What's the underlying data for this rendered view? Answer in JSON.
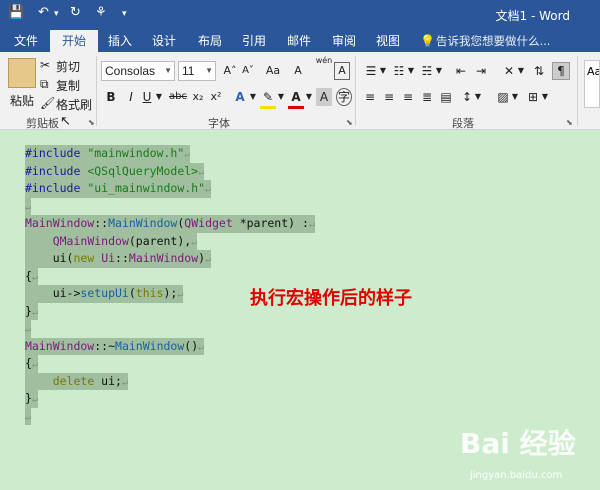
{
  "titlebar": {
    "title": "文档1 - Word",
    "save_icon": "💾",
    "undo_icon": "↶",
    "undo_dropdown": "▾",
    "redo_icon": "↻",
    "tree_icon": "⚘",
    "customize_icon": "▾"
  },
  "tabs": {
    "file": "文件",
    "home": "开始",
    "insert": "插入",
    "design": "设计",
    "layout": "布局",
    "references": "引用",
    "mailings": "邮件",
    "review": "审阅",
    "view": "视图",
    "tellme": "告诉我您想要做什么..."
  },
  "clipboard": {
    "paste": "粘贴",
    "cut": "剪切",
    "copy": "复制",
    "format_painter": "格式刷",
    "label": "剪贴板"
  },
  "font": {
    "name": "Consolas",
    "size": "11",
    "label": "字体",
    "bold": "B",
    "italic": "I",
    "underline": "U",
    "strike": "abc",
    "subscript": "x₂",
    "superscript": "x²",
    "grow": "A˄",
    "shrink": "A˅",
    "case": "Aa",
    "wen": "wén",
    "border_char": "A",
    "clear": "A"
  },
  "paragraph": {
    "label": "段落"
  },
  "styles": {
    "preview": "Aa"
  },
  "document": {
    "lines": [
      [
        {
          "t": "#include ",
          "c": "pre"
        },
        {
          "t": "\"mainwindow.h\"",
          "c": "str"
        }
      ],
      [
        {
          "t": "#include ",
          "c": "pre"
        },
        {
          "t": "<QSqlQueryModel>",
          "c": "str"
        }
      ],
      [
        {
          "t": "#include ",
          "c": "pre"
        },
        {
          "t": "\"ui_mainwindow.h\"",
          "c": "str"
        }
      ],
      [],
      [
        {
          "t": "MainWindow",
          "c": "cls"
        },
        {
          "t": "::",
          "c": "pl"
        },
        {
          "t": "MainWindow",
          "c": "fn"
        },
        {
          "t": "(",
          "c": "pl"
        },
        {
          "t": "QWidget",
          "c": "cls"
        },
        {
          "t": " *parent) :",
          "c": "pl"
        }
      ],
      [
        {
          "t": "    ",
          "c": "pl"
        },
        {
          "t": "QMainWindow",
          "c": "cls"
        },
        {
          "t": "(parent),",
          "c": "pl"
        }
      ],
      [
        {
          "t": "    ui(",
          "c": "pl"
        },
        {
          "t": "new",
          "c": "kw"
        },
        {
          "t": " ",
          "c": "pl"
        },
        {
          "t": "Ui",
          "c": "cls"
        },
        {
          "t": "::",
          "c": "pl"
        },
        {
          "t": "MainWindow",
          "c": "cls"
        },
        {
          "t": ")",
          "c": "pl"
        }
      ],
      [
        {
          "t": "{",
          "c": "pl"
        }
      ],
      [
        {
          "t": "    ui->",
          "c": "pl"
        },
        {
          "t": "setupUi",
          "c": "fn"
        },
        {
          "t": "(",
          "c": "pl"
        },
        {
          "t": "this",
          "c": "kw"
        },
        {
          "t": ");",
          "c": "pl"
        }
      ],
      [
        {
          "t": "}",
          "c": "pl"
        }
      ],
      [],
      [
        {
          "t": "MainWindow",
          "c": "cls"
        },
        {
          "t": "::~",
          "c": "pl"
        },
        {
          "t": "MainWindow",
          "c": "fn"
        },
        {
          "t": "()",
          "c": "pl"
        }
      ],
      [
        {
          "t": "{",
          "c": "pl"
        }
      ],
      [
        {
          "t": "    ",
          "c": "pl"
        },
        {
          "t": "delete",
          "c": "kw"
        },
        {
          "t": " ui;",
          "c": "pl"
        }
      ],
      [
        {
          "t": "}",
          "c": "pl"
        }
      ],
      []
    ],
    "paragraph_mark": "↵",
    "annotation": "执行宏操作后的样子"
  },
  "watermark": {
    "logo": "Bai 经验",
    "url": "jingyan.baidu.com"
  }
}
